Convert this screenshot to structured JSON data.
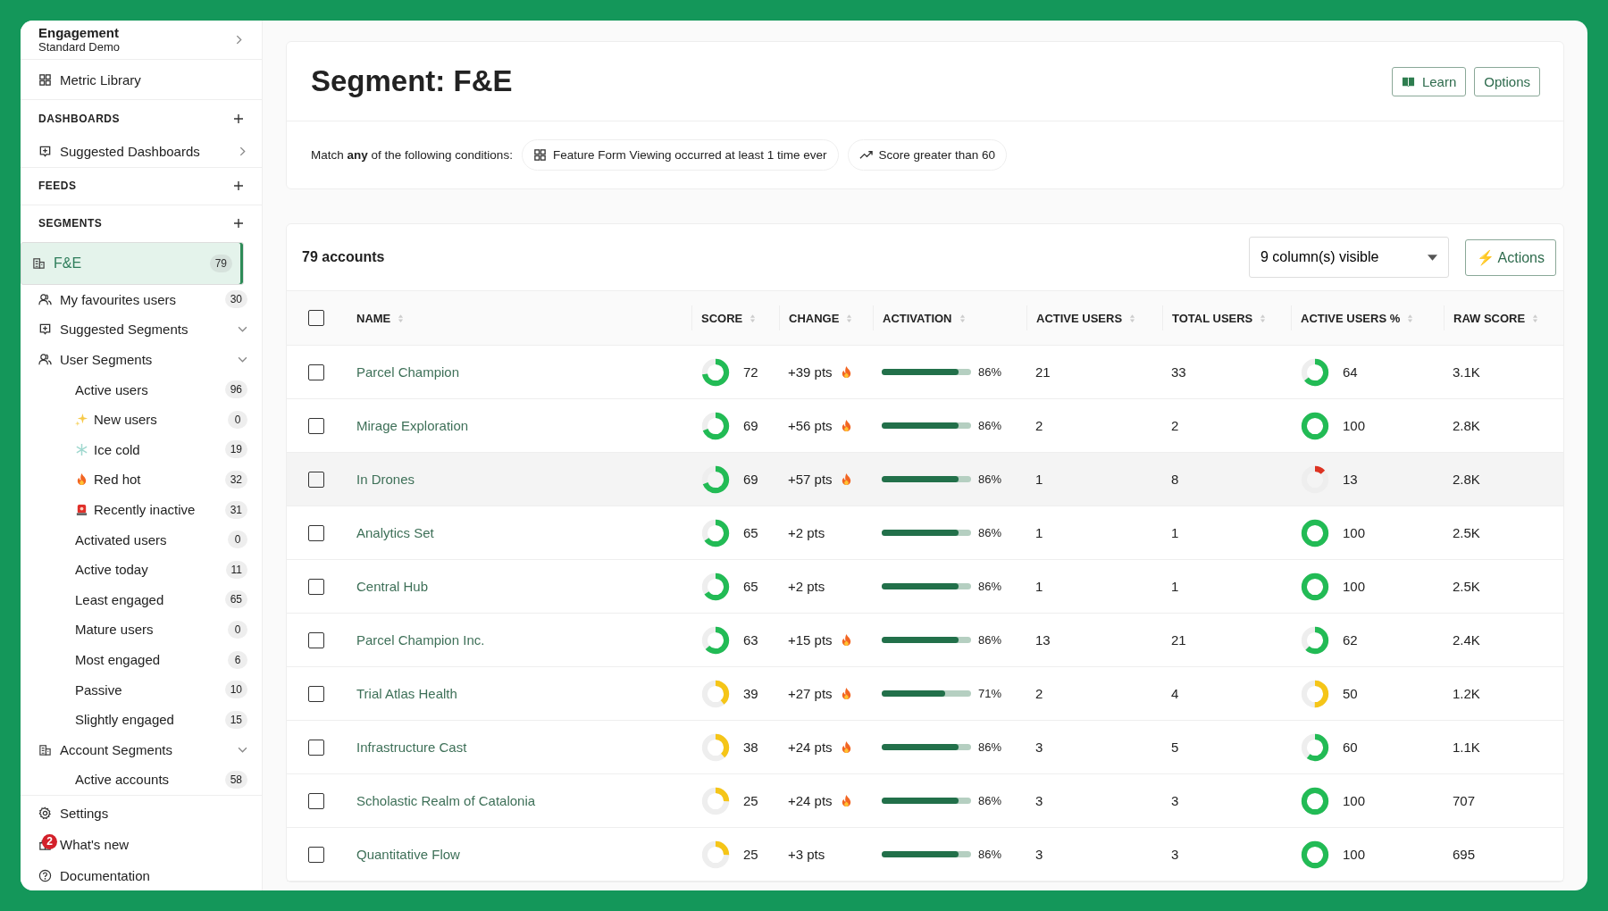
{
  "workspace": {
    "title": "Engagement",
    "subtitle": "Standard Demo"
  },
  "sidebar": {
    "items": [
      {
        "kind": "link",
        "label": "Metric Library"
      },
      {
        "kind": "section",
        "label": "DASHBOARDS"
      },
      {
        "kind": "link",
        "label": "Suggested Dashboards",
        "expanded": false
      },
      {
        "kind": "section",
        "label": "FEEDS"
      },
      {
        "kind": "section",
        "label": "SEGMENTS"
      },
      {
        "kind": "link",
        "label": "F&E",
        "count": "79",
        "selected": true
      },
      {
        "kind": "link",
        "label": "My favourites users",
        "count": "30",
        "selected": false
      },
      {
        "kind": "link",
        "label": "Suggested Segments",
        "expanded": true
      },
      {
        "kind": "link",
        "label": "User Segments",
        "expanded": true
      },
      {
        "kind": "sub",
        "label": "Active users",
        "count": "96"
      },
      {
        "kind": "sub",
        "label": "New users",
        "count": "0"
      },
      {
        "kind": "sub",
        "label": "Ice cold",
        "count": "19"
      },
      {
        "kind": "sub",
        "label": "Red hot",
        "count": "32"
      },
      {
        "kind": "sub",
        "label": "Recently inactive",
        "count": "31"
      },
      {
        "kind": "sub",
        "label": "Activated users",
        "count": "0"
      },
      {
        "kind": "sub",
        "label": "Active today",
        "count": "11"
      },
      {
        "kind": "sub",
        "label": "Least engaged",
        "count": "65"
      },
      {
        "kind": "sub",
        "label": "Mature users",
        "count": "0"
      },
      {
        "kind": "sub",
        "label": "Most engaged",
        "count": "6"
      },
      {
        "kind": "sub",
        "label": "Passive",
        "count": "10"
      },
      {
        "kind": "sub",
        "label": "Slightly engaged",
        "count": "15"
      },
      {
        "kind": "link",
        "label": "Account Segments",
        "expanded": true
      },
      {
        "kind": "sub",
        "label": "Active accounts",
        "count": "58"
      }
    ]
  },
  "footer": [
    {
      "label": "Settings"
    },
    {
      "label": "What's new",
      "badge": "2"
    },
    {
      "label": "Documentation"
    }
  ],
  "page": {
    "title": "Segment: F&E",
    "buttons": [
      "Learn",
      "Options"
    ],
    "conditions": {
      "text": "Match **any** of the following conditions:",
      "chips": [
        "Feature Form Viewing occurred at least 1 time ever",
        "Score greater than 60"
      ]
    }
  },
  "table": {
    "count": "79 accounts",
    "columns_select": "9 column(s) visible",
    "actions": "⚡ Actions",
    "select_all": {
      "checked": false
    },
    "columns": [
      "NAME",
      "SCORE",
      "CHANGE",
      "ACTIVATION",
      "ACTIVE USERS",
      "TOTAL USERS",
      "ACTIVE USERS %",
      "RAW SCORE"
    ],
    "rows": [
      {
        "checked": false,
        "name": "Parcel Champion",
        "score": {
          "text": "72",
          "color": "#22bb55"
        },
        "change": "+39 pts",
        "hot": true,
        "activation": {
          "text": "86%",
          "level": 0.86
        },
        "active_users": "21",
        "total_users": "33",
        "active_pct": {
          "text": "64",
          "color": "#22bb55"
        },
        "raw_score": "3.1K",
        "hovered": false
      },
      {
        "checked": false,
        "name": "Mirage Exploration",
        "score": {
          "text": "69",
          "color": "#22bb55"
        },
        "change": "+56 pts",
        "hot": true,
        "activation": {
          "text": "86%",
          "level": 0.86
        },
        "active_users": "2",
        "total_users": "2",
        "active_pct": {
          "text": "100",
          "color": "#22bb55"
        },
        "raw_score": "2.8K",
        "hovered": false
      },
      {
        "checked": false,
        "name": "In Drones",
        "score": {
          "text": "69",
          "color": "#22bb55"
        },
        "change": "+57 pts",
        "hot": true,
        "activation": {
          "text": "86%",
          "level": 0.86
        },
        "active_users": "1",
        "total_users": "8",
        "active_pct": {
          "text": "13",
          "color": "#dd3322"
        },
        "raw_score": "2.8K",
        "hovered": true
      },
      {
        "checked": false,
        "name": "Analytics Set",
        "score": {
          "text": "65",
          "color": "#22bb55"
        },
        "change": "+2 pts",
        "hot": false,
        "activation": {
          "text": "86%",
          "level": 0.86
        },
        "active_users": "1",
        "total_users": "1",
        "active_pct": {
          "text": "100",
          "color": "#22bb55"
        },
        "raw_score": "2.5K",
        "hovered": false
      },
      {
        "checked": false,
        "name": "Central Hub",
        "score": {
          "text": "65",
          "color": "#22bb55"
        },
        "change": "+2 pts",
        "hot": false,
        "activation": {
          "text": "86%",
          "level": 0.86
        },
        "active_users": "1",
        "total_users": "1",
        "active_pct": {
          "text": "100",
          "color": "#22bb55"
        },
        "raw_score": "2.5K",
        "hovered": false
      },
      {
        "checked": false,
        "name": "Parcel Champion Inc.",
        "score": {
          "text": "63",
          "color": "#22bb55"
        },
        "change": "+15 pts",
        "hot": true,
        "activation": {
          "text": "86%",
          "level": 0.86
        },
        "active_users": "13",
        "total_users": "21",
        "active_pct": {
          "text": "62",
          "color": "#22bb55"
        },
        "raw_score": "2.4K",
        "hovered": false
      },
      {
        "checked": false,
        "name": "Trial Atlas Health",
        "score": {
          "text": "39",
          "color": "#f5c518"
        },
        "change": "+27 pts",
        "hot": true,
        "activation": {
          "text": "71%",
          "level": 0.71
        },
        "active_users": "2",
        "total_users": "4",
        "active_pct": {
          "text": "50",
          "color": "#f5c518"
        },
        "raw_score": "1.2K",
        "hovered": false
      },
      {
        "checked": false,
        "name": "Infrastructure Cast",
        "score": {
          "text": "38",
          "color": "#f5c518"
        },
        "change": "+24 pts",
        "hot": true,
        "activation": {
          "text": "86%",
          "level": 0.86
        },
        "active_users": "3",
        "total_users": "5",
        "active_pct": {
          "text": "60",
          "color": "#22bb55"
        },
        "raw_score": "1.1K",
        "hovered": false
      },
      {
        "checked": false,
        "name": "Scholastic Realm of Catalonia",
        "score": {
          "text": "25",
          "color": "#f5c518"
        },
        "change": "+24 pts",
        "hot": true,
        "activation": {
          "text": "86%",
          "level": 0.86
        },
        "active_users": "3",
        "total_users": "3",
        "active_pct": {
          "text": "100",
          "color": "#22bb55"
        },
        "raw_score": "707",
        "hovered": false
      },
      {
        "checked": false,
        "name": "Quantitative Flow",
        "score": {
          "text": "25",
          "color": "#f5c518"
        },
        "change": "+3 pts",
        "hot": false,
        "activation": {
          "text": "86%",
          "level": 0.86
        },
        "active_users": "3",
        "total_users": "3",
        "active_pct": {
          "text": "100",
          "color": "#22bb55"
        },
        "raw_score": "695",
        "hovered": false
      }
    ]
  }
}
